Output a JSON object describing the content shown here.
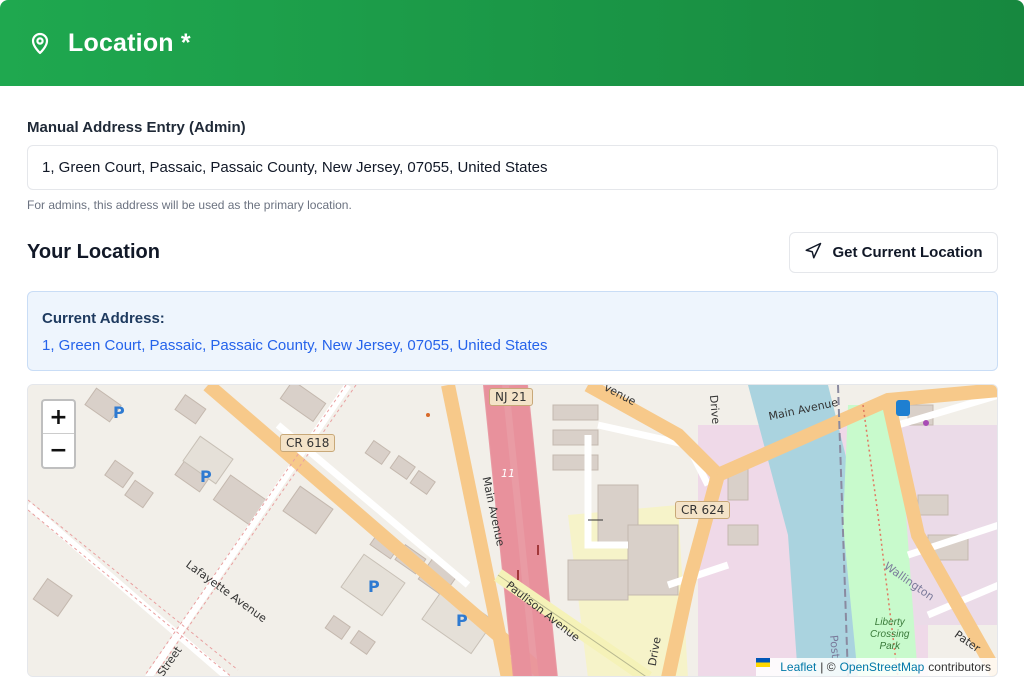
{
  "header": {
    "title": "Location *",
    "icon": "map-pin-icon"
  },
  "manual_entry": {
    "label": "Manual Address Entry (Admin)",
    "value": "1, Green Court, Passaic, Passaic County, New Jersey, 07055, United States",
    "help": "For admins, this address will be used as the primary location."
  },
  "your_location": {
    "title": "Your Location",
    "button_label": "Get Current Location",
    "button_icon": "navigation-arrow-icon"
  },
  "current_address": {
    "label": "Current Address:",
    "value": "1, Green Court, Passaic, Passaic County, New Jersey, 07055, United States"
  },
  "map": {
    "zoom_in": "+",
    "zoom_out": "−",
    "labels": {
      "nj21": "NJ 21",
      "cr618": "CR 618",
      "cr624": "CR 624",
      "main_avenue_right": "Main Avenue",
      "main_avenue_vertical": "Main Avenue",
      "paulison": "Paulison Avenue",
      "lafayette": "Lafayette Avenue",
      "avenue_top": "venue",
      "drive_top": "Drive",
      "drive_bottom": "Drive",
      "wallington": "Wallington",
      "pater": "Pater",
      "street": "Street",
      "post": "Post",
      "park": "Liberty\nCrossing\nPark",
      "route_11": "11",
      "parking": "P"
    },
    "attribution": {
      "leaflet": "Leaflet",
      "sep": "| ©",
      "osm": "OpenStreetMap",
      "contributors": "contributors"
    }
  },
  "colors": {
    "header_start": "#1fa84f",
    "header_end": "#17883f",
    "link_blue": "#2563eb",
    "highway_pink": "#e8919c",
    "road_orange": "#f7c98a",
    "river_blue": "#aad3df"
  }
}
